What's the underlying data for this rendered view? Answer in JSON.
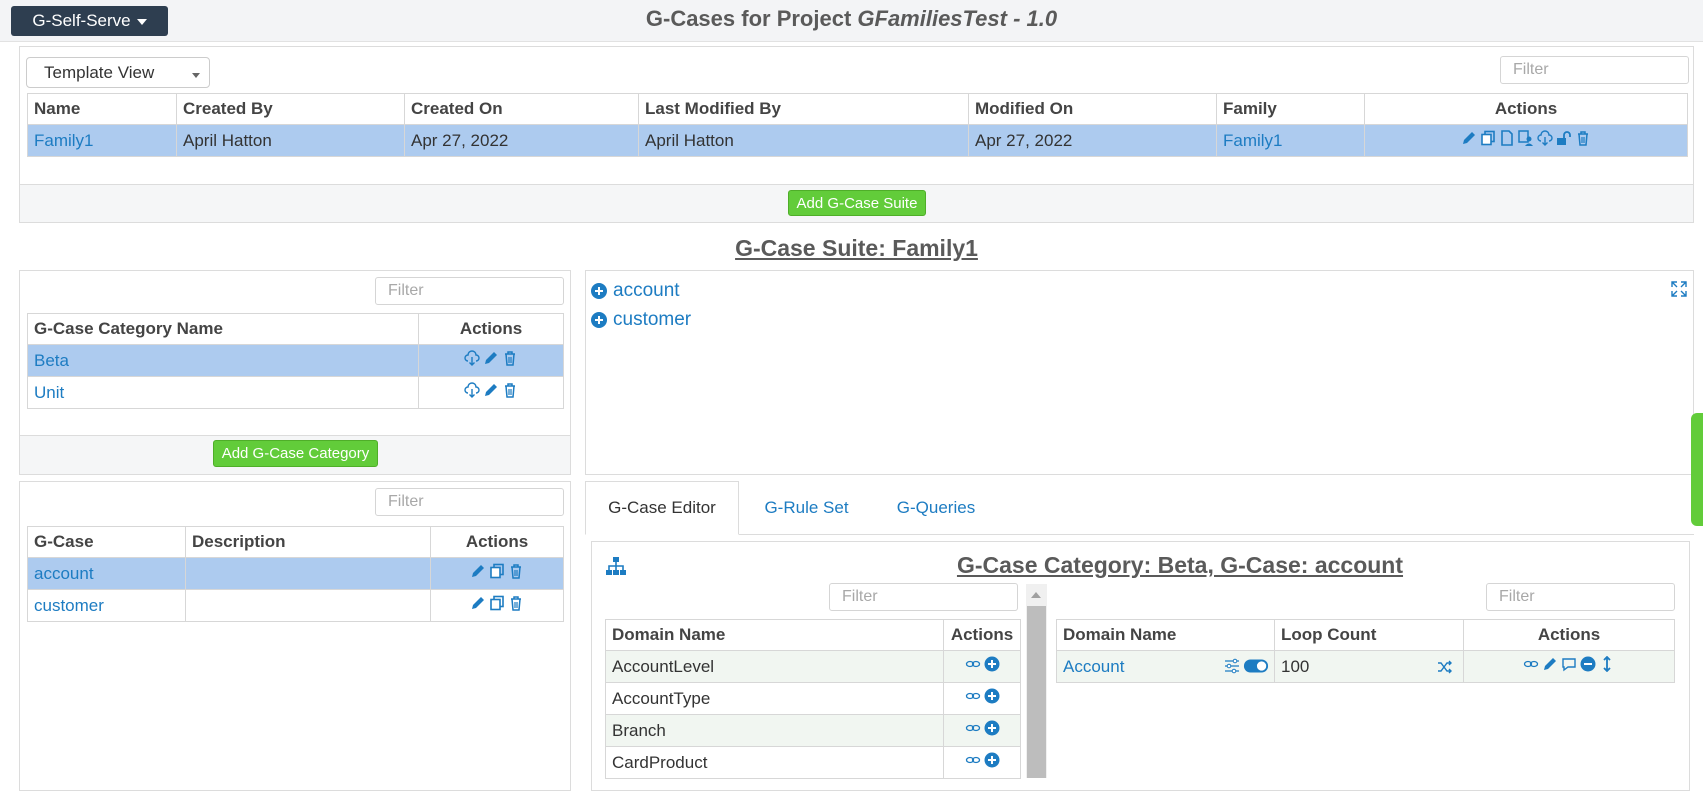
{
  "header": {
    "menu_label": "G-Self-Serve",
    "title_prefix": "G-Cases for Project ",
    "project_name": "GFamiliesTest - 1.0"
  },
  "templates": {
    "view_select": "Template View",
    "filter_placeholder": "Filter",
    "columns": [
      "Name",
      "Created By",
      "Created On",
      "Last Modified By",
      "Modified On",
      "Family",
      "Actions"
    ],
    "rows": [
      {
        "name": "Family1",
        "created_by": "April Hatton",
        "created_on": "Apr 27, 2022",
        "modified_by": "April Hatton",
        "modified_on": "Apr 27, 2022",
        "family": "Family1"
      }
    ],
    "add_button": "Add G-Case Suite"
  },
  "suite_title": "G-Case Suite: Family1",
  "categories": {
    "filter_placeholder": "Filter",
    "columns": [
      "G-Case Category Name",
      "Actions"
    ],
    "rows": [
      {
        "name": "Beta"
      },
      {
        "name": "Unit"
      }
    ],
    "add_button": "Add G-Case Category"
  },
  "gcases": {
    "filter_placeholder": "Filter",
    "columns": [
      "G-Case",
      "Description",
      "Actions"
    ],
    "rows": [
      {
        "name": "account",
        "description": ""
      },
      {
        "name": "customer",
        "description": ""
      }
    ]
  },
  "tree": {
    "items": [
      "account",
      "customer"
    ]
  },
  "tabs": [
    "G-Case Editor",
    "G-Rule Set",
    "G-Queries"
  ],
  "editor": {
    "title": "G-Case Category: Beta, G-Case: account",
    "left_filter_placeholder": "Filter",
    "right_filter_placeholder": "Filter",
    "domain_columns": [
      "Domain Name",
      "Actions"
    ],
    "domains": [
      "AccountLevel",
      "AccountType",
      "Branch",
      "CardProduct"
    ],
    "selected_columns": [
      "Domain Name",
      "Loop Count",
      "Actions"
    ],
    "selected": [
      {
        "name": "Account",
        "loop_count": "100"
      }
    ]
  },
  "colors": {
    "accent": "#1d7cc2",
    "selected_row": "#adcbef",
    "green_button": "#62cc3a",
    "menu_bg": "#2e3e50"
  }
}
